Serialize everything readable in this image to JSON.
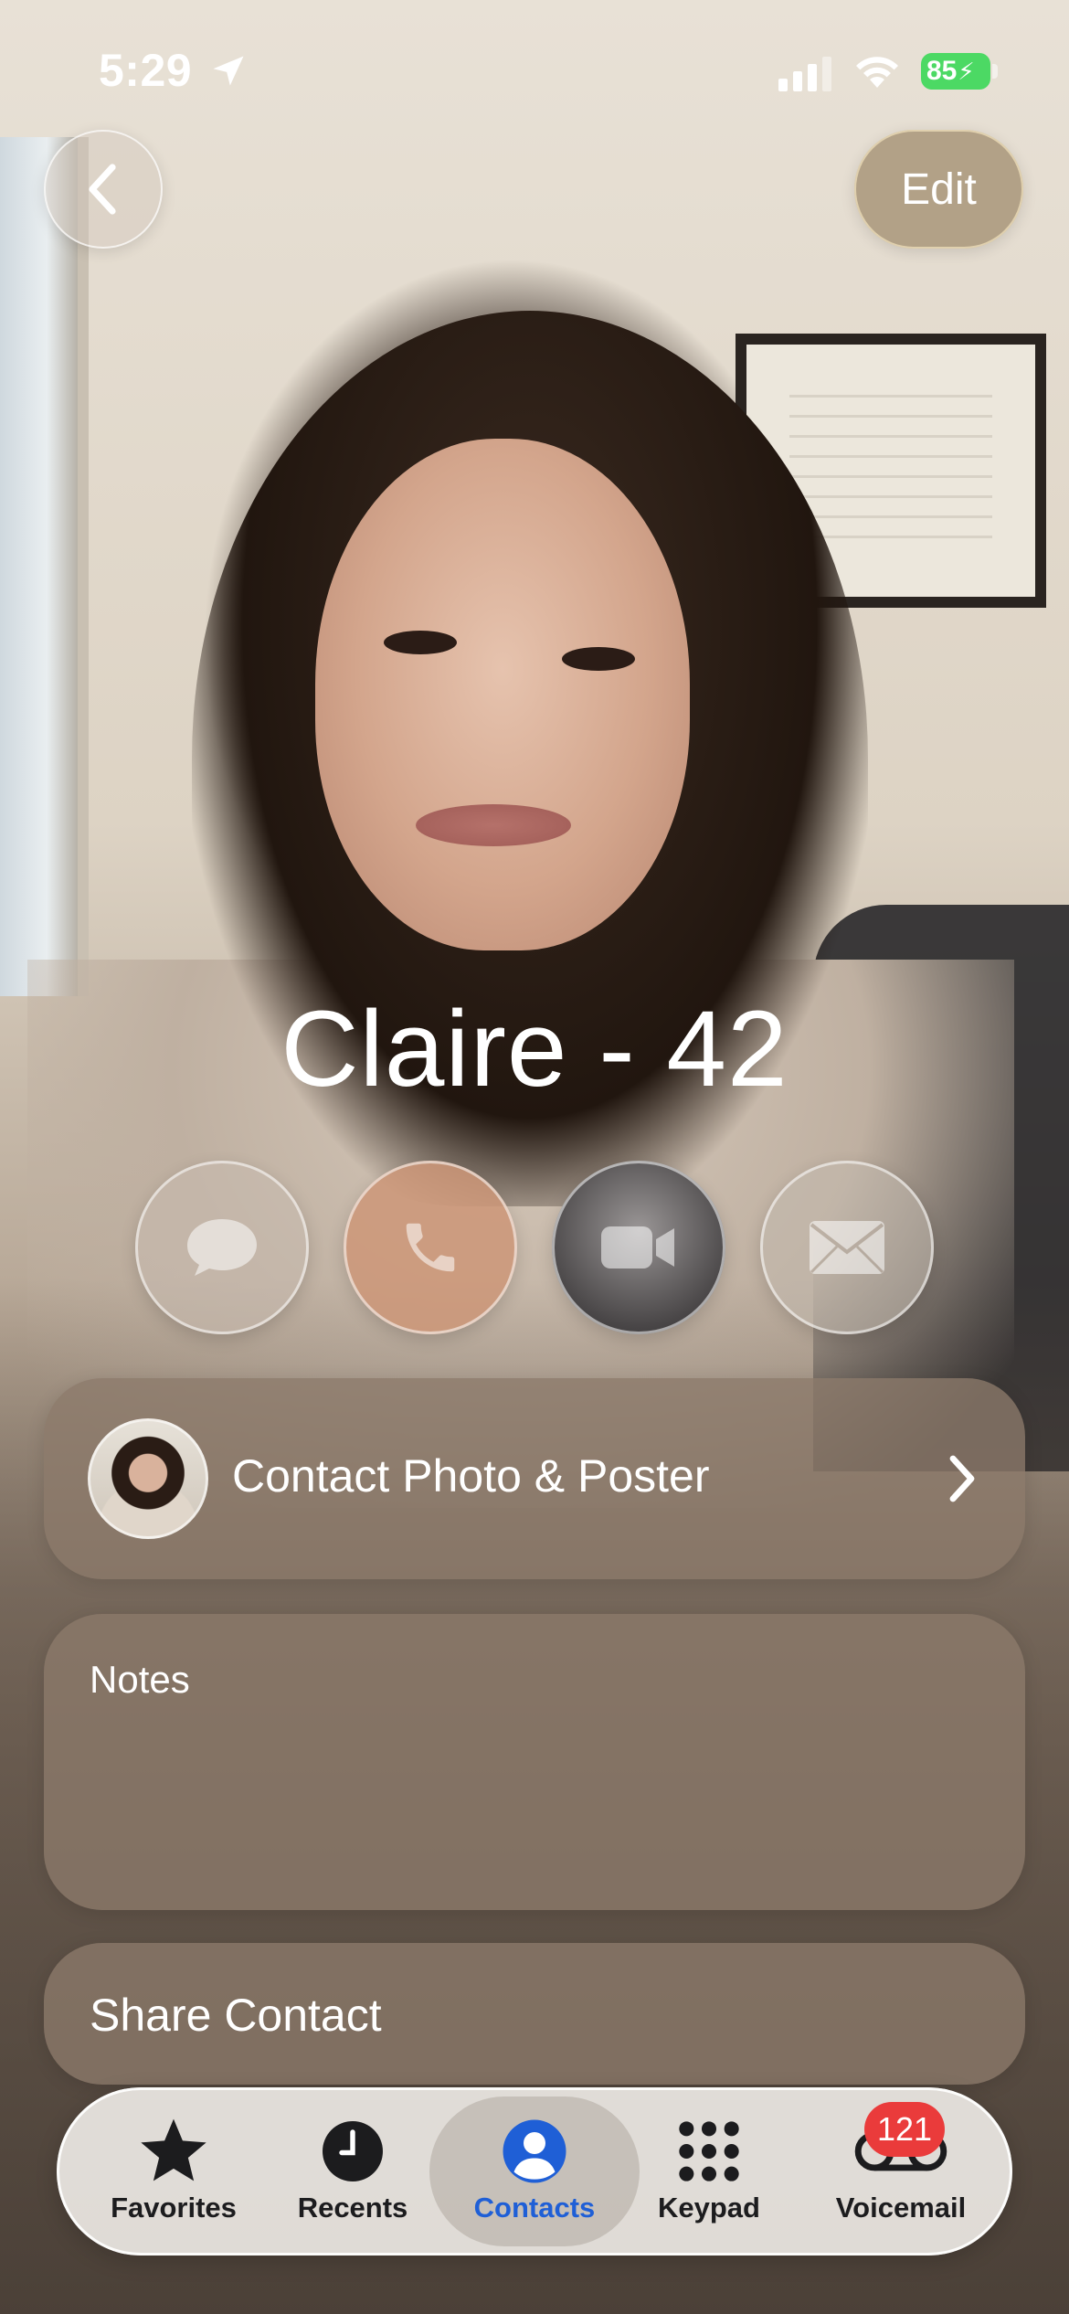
{
  "status_bar": {
    "time": "5:29",
    "battery": "85",
    "icons": [
      "location-arrow-icon",
      "cellular-signal-icon",
      "wifi-icon",
      "battery-charging-icon"
    ]
  },
  "header": {
    "back_icon": "chevron-left-icon",
    "edit_label": "Edit"
  },
  "contact": {
    "name": "Claire - 42"
  },
  "actions": [
    {
      "name": "message",
      "icon": "message-bubble-icon"
    },
    {
      "name": "call",
      "icon": "phone-icon"
    },
    {
      "name": "video",
      "icon": "video-camera-icon"
    },
    {
      "name": "mail",
      "icon": "envelope-icon"
    }
  ],
  "cards": {
    "photo_poster_label": "Contact Photo & Poster",
    "notes_label": "Notes",
    "share_label": "Share Contact"
  },
  "tabbar": {
    "tabs": [
      {
        "label": "Favorites",
        "icon": "star-icon"
      },
      {
        "label": "Recents",
        "icon": "clock-icon"
      },
      {
        "label": "Contacts",
        "icon": "person-circle-icon",
        "selected": true
      },
      {
        "label": "Keypad",
        "icon": "keypad-grid-icon"
      },
      {
        "label": "Voicemail",
        "icon": "voicemail-icon"
      }
    ],
    "voicemail_badge": "121"
  },
  "colors": {
    "accent": "#1f5fd6",
    "badge": "#ea3b3b",
    "battery": "#4cd964"
  }
}
